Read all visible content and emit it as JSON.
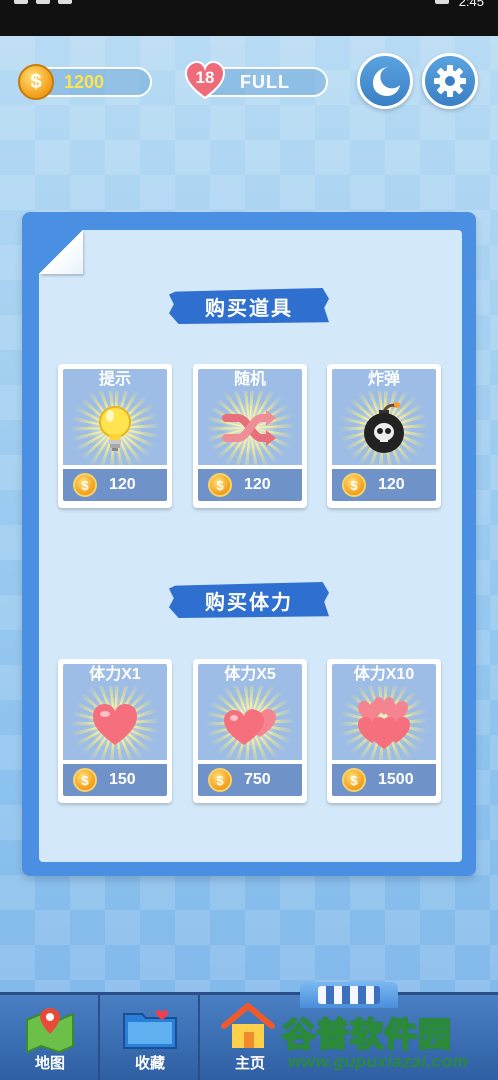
{
  "status_bar": {
    "time": "2:45"
  },
  "hud": {
    "coins": "1200",
    "coin_symbol": "$",
    "lives": "18",
    "lives_status": "FULL"
  },
  "sections": {
    "items_title": "购买道具",
    "energy_title": "购买体力"
  },
  "items": [
    {
      "name": "提示",
      "icon": "lightbulb-icon",
      "price": "120"
    },
    {
      "name": "随机",
      "icon": "shuffle-icon",
      "price": "120"
    },
    {
      "name": "炸弹",
      "icon": "bomb-icon",
      "price": "120"
    }
  ],
  "energy": [
    {
      "name": "体力X1",
      "icon": "heart-icon",
      "price": "150"
    },
    {
      "name": "体力X5",
      "icon": "hearts-icon",
      "price": "750"
    },
    {
      "name": "体力X10",
      "icon": "many-hearts-icon",
      "price": "1500"
    }
  ],
  "nav": {
    "map": "地图",
    "favorites": "收藏",
    "home": "主页"
  },
  "watermark": {
    "brand": "谷普软件园",
    "url": "www.gupuxiazai.com"
  },
  "colors": {
    "panel": "#4b8fe2",
    "panel_inner": "#d3e9fa",
    "coin_text": "#ffe44d",
    "nav": "#3a6db3"
  }
}
